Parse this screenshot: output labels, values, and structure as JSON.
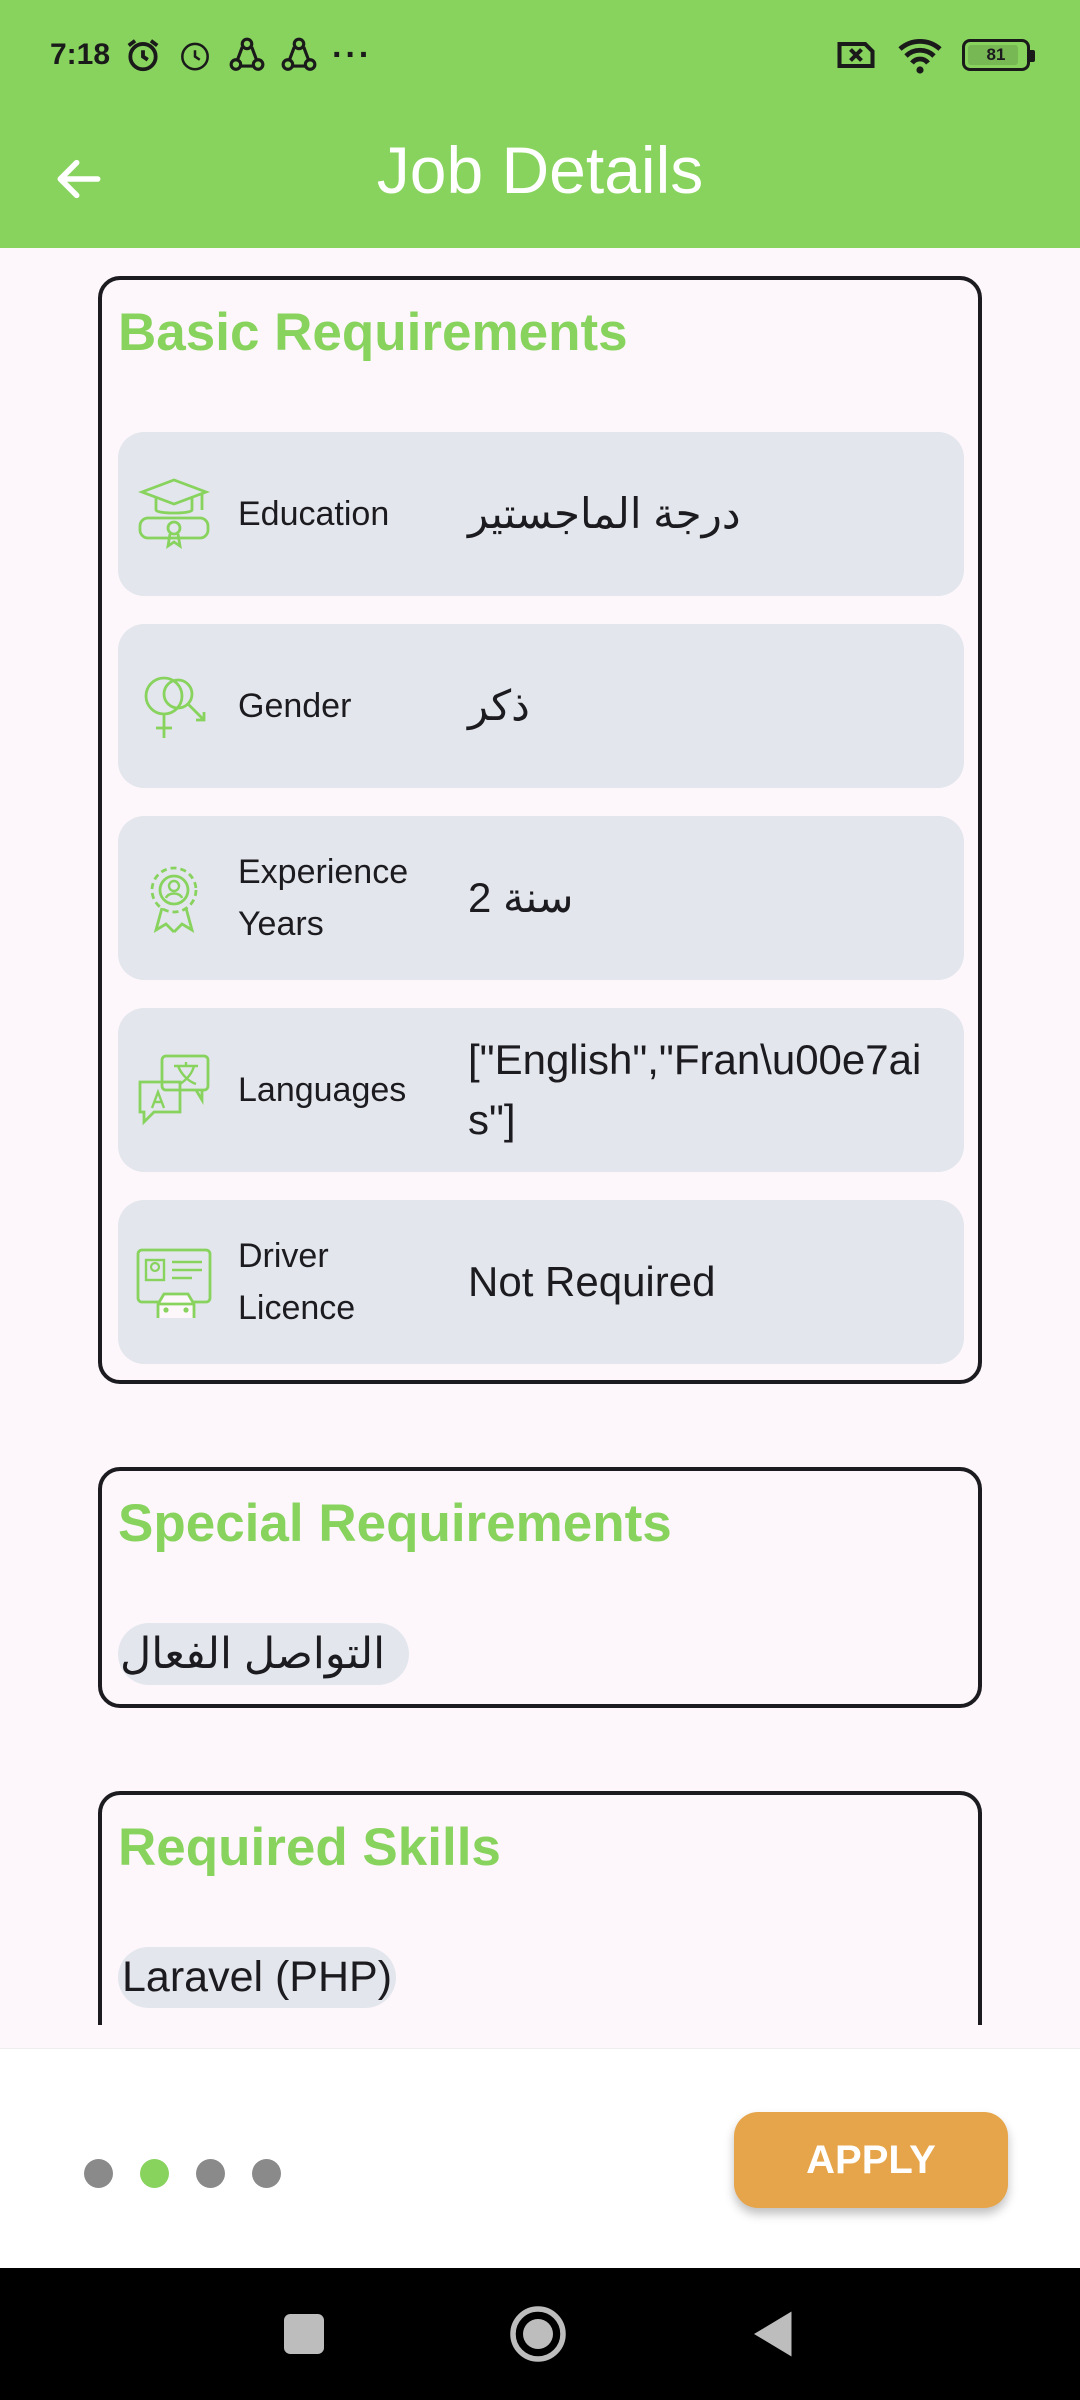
{
  "status_bar": {
    "time": "7:18",
    "battery": "81",
    "more": "···"
  },
  "app_bar": {
    "title": "Job Details"
  },
  "basic_requirements": {
    "title": "Basic Requirements",
    "rows": [
      {
        "icon": "graduation-cap-icon",
        "label": "Education",
        "value": "درجة الماجستير"
      },
      {
        "icon": "gender-icon",
        "label": "Gender",
        "value": "ذكر"
      },
      {
        "icon": "award-badge-icon",
        "label": "Experience Years",
        "value": "2 سنة"
      },
      {
        "icon": "translate-icon",
        "label": "Languages",
        "value": "[\"English\",\"Fran\\u00e7ais\"]"
      },
      {
        "icon": "driver-license-icon",
        "label": "Driver Licence",
        "value": "Not Required"
      }
    ]
  },
  "special_requirements": {
    "title": "Special Requirements",
    "chips": [
      "التواصل الفعال"
    ]
  },
  "required_skills": {
    "title": "Required Skills",
    "chips": [
      "Laravel (PHP)"
    ]
  },
  "pager": {
    "active_index": 1,
    "count": 4
  },
  "apply_button": {
    "label": "APPLY"
  },
  "colors": {
    "primary": "#88d35e",
    "accent": "#e6a54a",
    "row_bg": "#e3e6ed"
  }
}
